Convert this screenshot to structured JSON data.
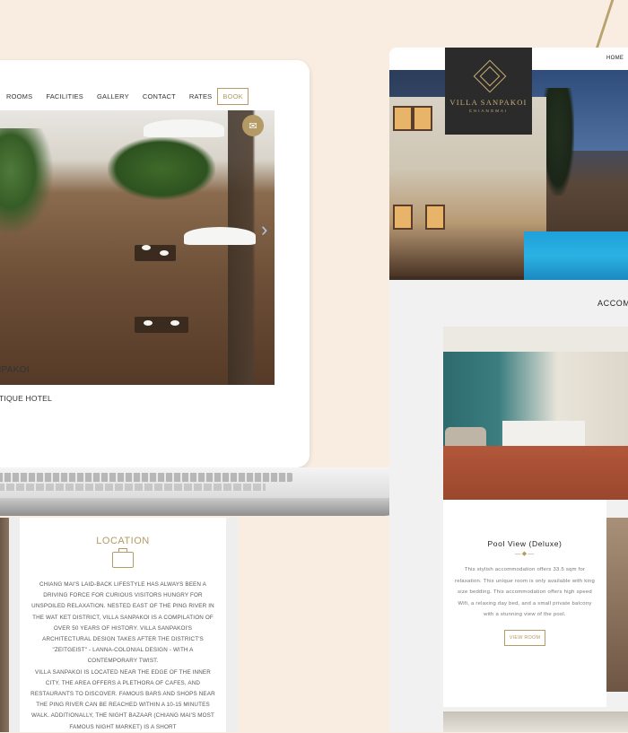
{
  "laptop": {
    "nav": [
      {
        "label": "ROOMS"
      },
      {
        "label": "FACILITIES"
      },
      {
        "label": "GALLERY"
      },
      {
        "label": "CONTACT"
      },
      {
        "label": "RATES"
      }
    ],
    "book_label": "BOOK",
    "caption_title": "SANPAKOI",
    "caption_sub": "BOUTIQUE HOTEL"
  },
  "phone": {
    "location_title": "LOCATION",
    "location_p1": "CHIANG MAI'S LAID-BACK LIFESTYLE HAS ALWAYS BEEN A DRIVING FORCE FOR CURIOUS VISITORS HUNGRY FOR UNSPOILED RELAXATION. NESTED EAST OF THE PING RIVER IN THE WAT KET DISTRICT, VILLA SANPAKOI IS A COMPILATION OF OVER 50 YEARS OF HISTORY. VILLA SANPAKOI'S ARCHITECTURAL DESIGN TAKES AFTER THE DISTRICT'S \"ZEITGEIST\" - LANNA-COLONIAL DESIGN - WITH A CONTEMPORARY TWIST.",
    "location_p2": "VILLA SANPAKOI IS LOCATED NEAR THE EDGE OF THE INNER CITY, THE AREA OFFERS A PLETHORA OF CAFES, AND RESTAURANTS TO DISCOVER. FAMOUS BARS AND SHOPS NEAR THE PING RIVER CAN BE REACHED WITHIN A 10-15 MINUTES WALK. ADDITIONALLY, THE NIGHT BAZAAR (CHIANG MAI'S MOST FAMOUS NIGHT MARKET) IS A SHORT"
  },
  "site": {
    "nav_home": "HOME",
    "logo_name": "VILLA SANPAKOI",
    "logo_city": "CHIANGMAI",
    "section_title": "ACCOM",
    "room": {
      "title": "Pool View (Deluxe)",
      "divider": "—◆—",
      "description": "This stylish accommodation offers 33.5 sqm for relaxation. This unique room is only available with king size bedding. This accommodation offers high speed Wifi, a relaxing day bed, and a small private balcony with a stunning view of the pool.",
      "button": "VIEW ROOM"
    }
  }
}
